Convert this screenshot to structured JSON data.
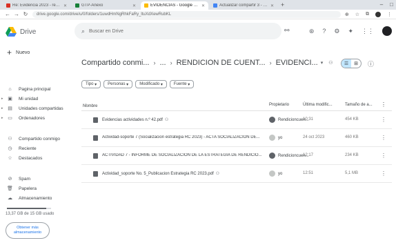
{
  "browser": {
    "tabs": [
      {
        "title": "Re: Evidencia 2023 - resumen de la...",
        "active": false
      },
      {
        "title": "GTP-Anexo",
        "active": false
      },
      {
        "title": "EVIDENCIAS - Google Drive",
        "active": true
      },
      {
        "title": "Actualizar compartir 3 - Pan...",
        "active": false
      }
    ],
    "new_tab": "+",
    "url": "drive.google.com/drive/u/0/folders/1uwdHmNgRhkFaRy_ltuXdXewRubKL"
  },
  "drive": {
    "app_name": "Drive",
    "search_placeholder": "Buscar en Drive",
    "new_button": "Nuevo",
    "nav": [
      {
        "label": "Pagina principal",
        "icon": "home-icon"
      },
      {
        "label": "Mi unidad",
        "icon": "my-drive-icon"
      },
      {
        "label": "Unidades compartidas",
        "icon": "shared-drives-icon"
      },
      {
        "label": "Ordenadores",
        "icon": "computers-icon"
      },
      {
        "label": "Compartido conmigo",
        "icon": "shared-with-me-icon"
      },
      {
        "label": "Reciente",
        "icon": "recent-icon"
      },
      {
        "label": "Destacados",
        "icon": "starred-icon"
      },
      {
        "label": "Spam",
        "icon": "spam-icon"
      },
      {
        "label": "Papelera",
        "icon": "trash-icon"
      },
      {
        "label": "Almacenamiento",
        "icon": "cloud-storage-icon"
      }
    ],
    "storage": {
      "text": "13,37 GB de 15 GB usado",
      "fraction": 0.89,
      "button_line1": "Obtener más",
      "button_line2": "almacenamiento"
    },
    "breadcrumb": {
      "root": "Compartido conmi...",
      "ellipsis": "...",
      "folder1": "RENDICION DE CUENT...",
      "current": "EVIDENCI..."
    },
    "filters": [
      "Tipo",
      "Personas",
      "Modificado",
      "Fuente"
    ],
    "columns": {
      "name": "Nombre",
      "owner": "Propietario",
      "modified": "Última modific...",
      "size": "Tamaño de a..."
    },
    "files": [
      {
        "name": "Evidencias actividades n.º 42.pdf",
        "owner": "Rendicioncuen...",
        "modified": "10:31",
        "size": "454 KB"
      },
      {
        "name": "Actividad-soporte 7 (Socializacion estrategia RC 2023) - ACTA SOCIALIZACION DE...",
        "owner": "yo",
        "modified": "24 oct 2023",
        "size": "460 KB"
      },
      {
        "name": "ACTIVIDAD 7 - INFORME DE SOCIALIZACION DE LA ESTRATEGIA DE RENDICIO...",
        "owner": "Rendicioncuen...",
        "modified": "12:17",
        "size": "234 KB"
      },
      {
        "name": "Actividad_soporte No. 5_Publicacion Estrategia RC 2023.pdf",
        "owner": "yo",
        "modified": "12:51",
        "size": "5,1 MB"
      }
    ]
  }
}
